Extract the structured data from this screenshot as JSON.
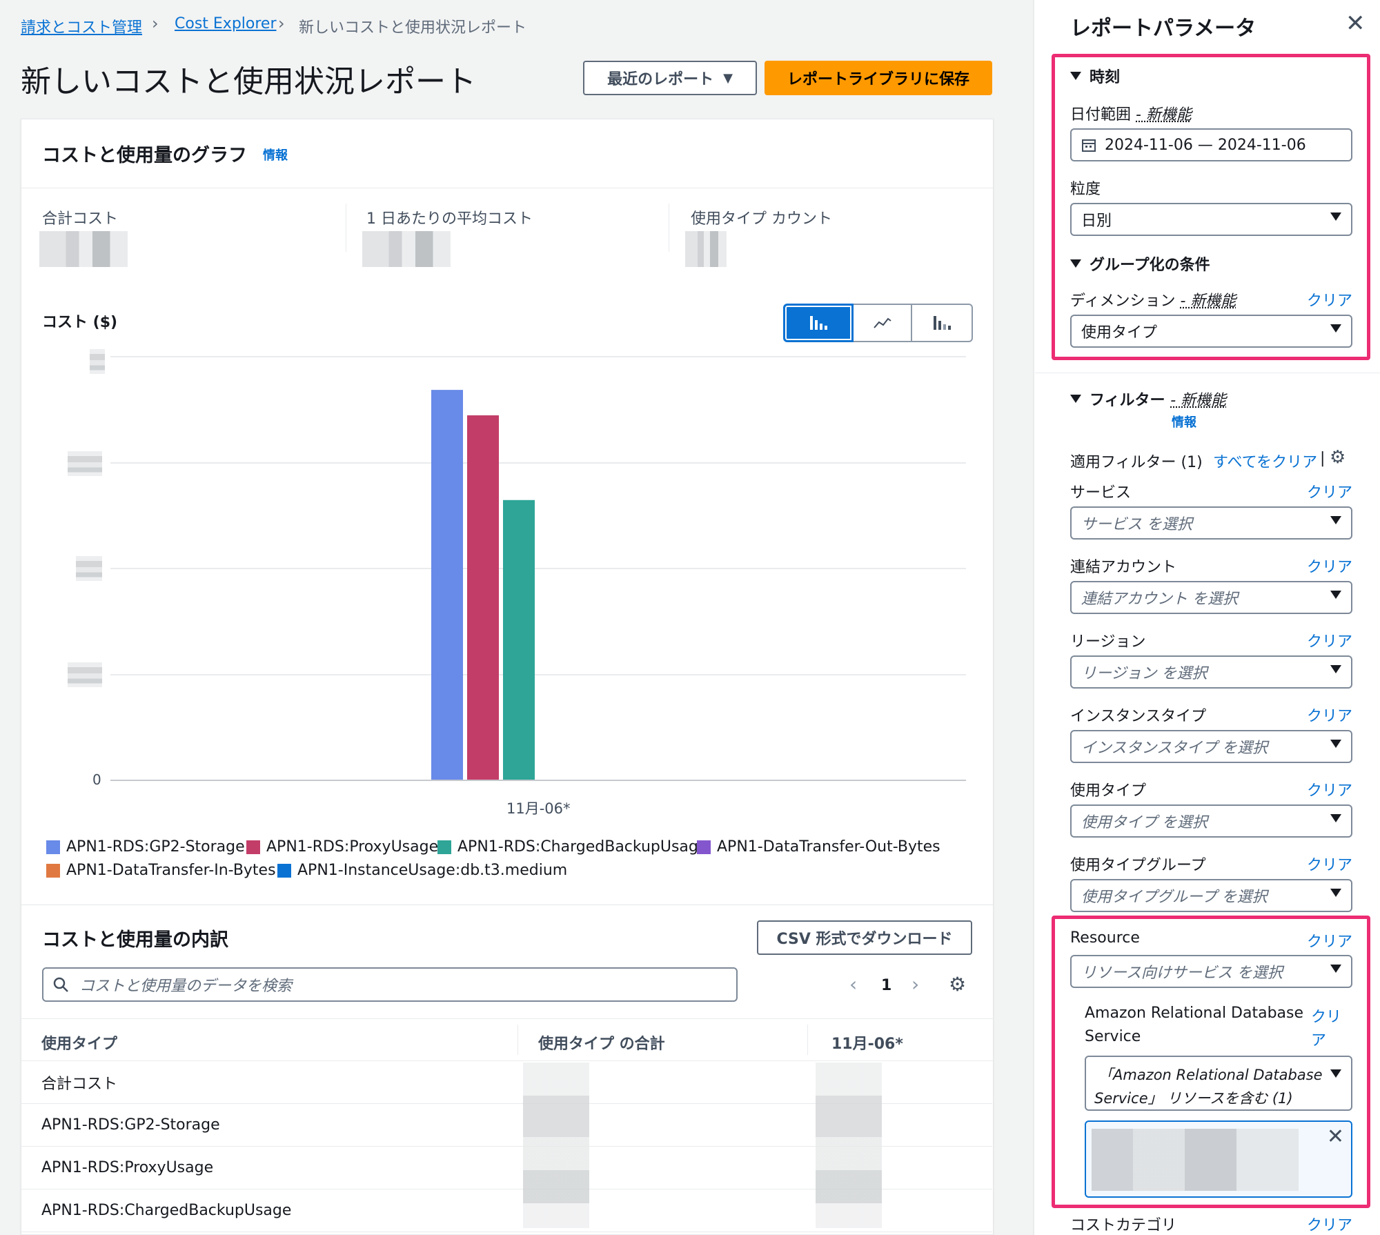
{
  "breadcrumbs": [
    "請求とコスト管理",
    "Cost Explorer",
    "新しいコストと使用状況レポート"
  ],
  "page_title": "新しいコストと使用状況レポート",
  "header_buttons": {
    "recent": "最近のレポート",
    "save": "レポートライブラリに保存"
  },
  "graph_card": {
    "title": "コストと使用量のグラフ",
    "info": "情報",
    "stats": [
      "合計コスト",
      "1 日あたりの平均コスト",
      "使用タイプ カウント"
    ],
    "axis_title": "コスト ($)",
    "zero_label": "0",
    "x_label": "11月-06*"
  },
  "chart_data": {
    "type": "bar",
    "categories": [
      "11月-06*"
    ],
    "series": [
      {
        "name": "APN1-RDS:GP2-Storage",
        "values": [
          0.92
        ],
        "color": "#688ae8"
      },
      {
        "name": "APN1-RDS:ProxyUsage",
        "values": [
          0.86
        ],
        "color": "#c33d69"
      },
      {
        "name": "APN1-RDS:ChargedBackupUsage",
        "values": [
          0.66
        ],
        "color": "#2ea597"
      },
      {
        "name": "APN1-DataTransfer-Out-Bytes",
        "values": [
          0
        ],
        "color": "#8456ce"
      },
      {
        "name": "APN1-DataTransfer-In-Bytes",
        "values": [
          0
        ],
        "color": "#e07941"
      },
      {
        "name": "APN1-InstanceUsage:db.t3.medium",
        "values": [
          0
        ],
        "color": "#0972d3"
      }
    ],
    "ylabel": "コスト ($)",
    "ylim": [
      0,
      1
    ],
    "grid": true,
    "legend": "bottom"
  },
  "breakdown": {
    "title": "コストと使用量の内訳",
    "csv_button": "CSV 形式でダウンロード",
    "search_placeholder": "コストと使用量のデータを検索",
    "page": "1",
    "columns": [
      "使用タイプ",
      "使用タイプ の合計",
      "11月-06*"
    ],
    "rows": [
      "合計コスト",
      "APN1-RDS:GP2-Storage",
      "APN1-RDS:ProxyUsage",
      "APN1-RDS:ChargedBackupUsage"
    ]
  },
  "panel": {
    "title": "レポートパラメータ",
    "time_section": "時刻",
    "date_range_label": "日付範囲",
    "new_feature": "- 新機能",
    "date_range_value": "2024-11-06 — 2024-11-06",
    "granularity_label": "粒度",
    "granularity_value": "日別",
    "group_section": "グループ化の条件",
    "dimension_label": "ディメンション",
    "dimension_value": "使用タイプ",
    "clear": "クリア",
    "filter_section": "フィルター",
    "info": "情報",
    "applied_filters": "適用フィルター (1)",
    "clear_all": "すべてをクリア",
    "filters": [
      {
        "label": "サービス",
        "placeholder": "サービス を選択"
      },
      {
        "label": "連結アカウント",
        "placeholder": "連結アカウント を選択"
      },
      {
        "label": "リージョン",
        "placeholder": "リージョン を選択"
      },
      {
        "label": "インスタンスタイプ",
        "placeholder": "インスタンスタイプ を選択"
      },
      {
        "label": "使用タイプ",
        "placeholder": "使用タイプ を選択"
      },
      {
        "label": "使用タイプグループ",
        "placeholder": "使用タイプグループ を選択"
      }
    ],
    "resource_label": "Resource",
    "resource_placeholder": "リソース向けサービス を選択",
    "rds_label_1": "Amazon Relational Database",
    "rds_label_2": "Service",
    "rds_clear_1": "クリ",
    "rds_clear_2": "ア",
    "rds_select_1": "「Amazon Relational Database",
    "rds_select_2": "Service」 リソースを含む (1)",
    "cost_category": "コストカテゴリ"
  }
}
